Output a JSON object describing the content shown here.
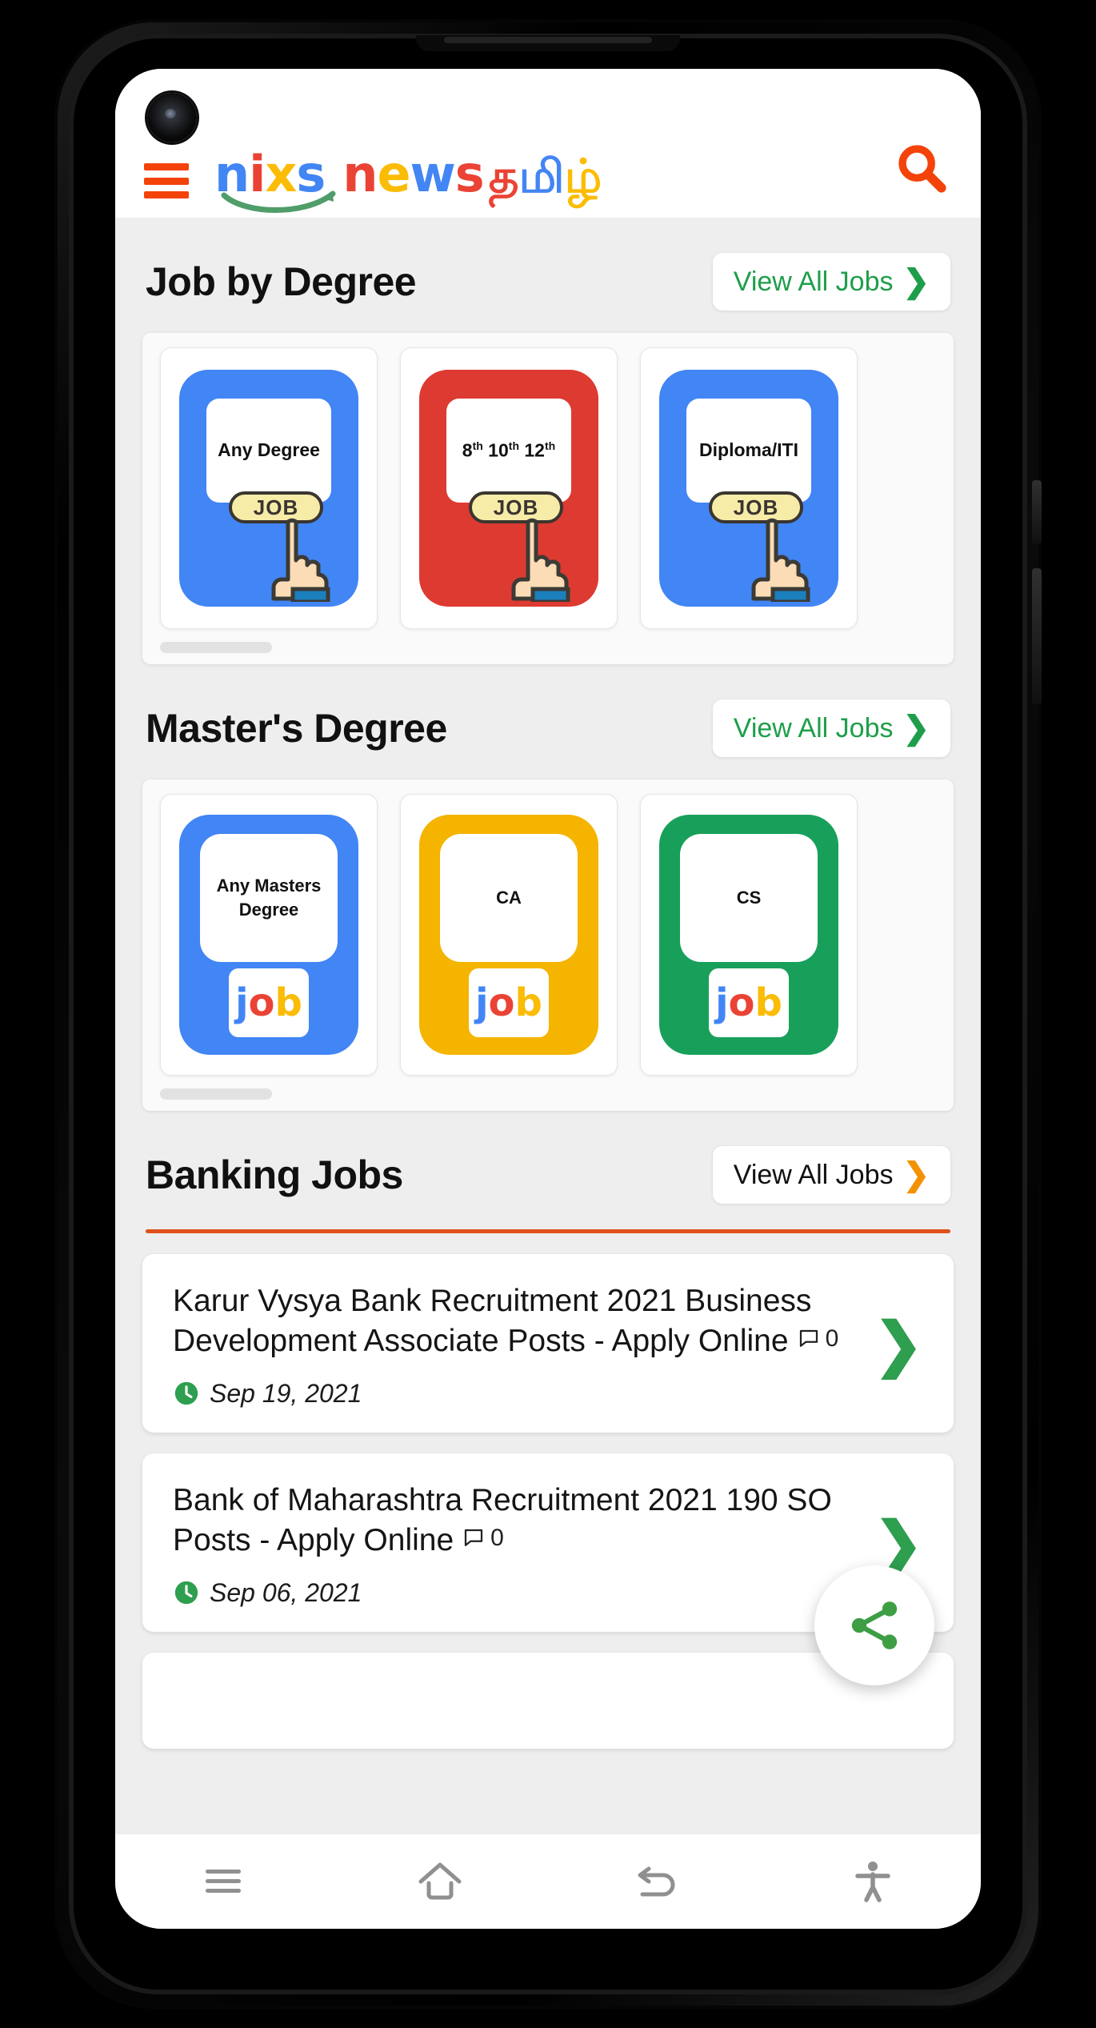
{
  "header": {
    "menu_icon": "hamburger-icon",
    "brand": {
      "part1": "n",
      "part2": "i",
      "part3": "x",
      "part4": "s",
      "word2": "news",
      "tamil": "தமிழ்"
    },
    "search_icon": "search-icon",
    "search_color": "#F4420B"
  },
  "sections": [
    {
      "title": "Job by Degree",
      "view_all_label": "View All Jobs",
      "view_all_chevron": "❯",
      "view_all_style": "green",
      "cards": [
        {
          "label": "Any Degree",
          "color": "#4285F4",
          "badge": "JOB"
        },
        {
          "label": "8th 10th 12th",
          "color": "#DD3A31",
          "badge": "JOB"
        },
        {
          "label": "Diploma/ITI",
          "color": "#4285F4",
          "badge": "JOB"
        }
      ]
    },
    {
      "title": "Master's Degree",
      "view_all_label": "View All Jobs",
      "view_all_chevron": "❯",
      "view_all_style": "green",
      "cards": [
        {
          "label": "Any Masters Degree",
          "color": "#4285F4",
          "badge": "job"
        },
        {
          "label": "CA",
          "color": "#F4B400",
          "badge": "job"
        },
        {
          "label": "CS",
          "color": "#18A05A",
          "badge": "job"
        }
      ]
    }
  ],
  "banking": {
    "title": "Banking Jobs",
    "view_all_label": "View All Jobs",
    "view_all_chevron": "❯",
    "divider_color": "#E0511B",
    "posts": [
      {
        "title": "Karur Vysya Bank Recruitment 2021 Business Development Associate Posts - Apply Online",
        "comments": "0",
        "date": "Sep 19, 2021",
        "arrow": "❯"
      },
      {
        "title": "Bank of Maharashtra Recruitment 2021 190 SO Posts - Apply Online",
        "comments": "0",
        "date": "Sep 06, 2021",
        "arrow": "❯"
      }
    ]
  },
  "fab": {
    "icon": "share-icon",
    "color": "#3E9E44"
  },
  "scroll_top": {
    "icon": "chevron-up-icon",
    "color": "#F39200"
  },
  "navbar": [
    {
      "icon": "recents-menu-icon"
    },
    {
      "icon": "home-icon"
    },
    {
      "icon": "back-icon"
    },
    {
      "icon": "accessibility-icon"
    }
  ],
  "colors": {
    "accent_orange": "#F4420B",
    "green": "#1e9e4a",
    "screen_bg": "#eeeeee"
  }
}
